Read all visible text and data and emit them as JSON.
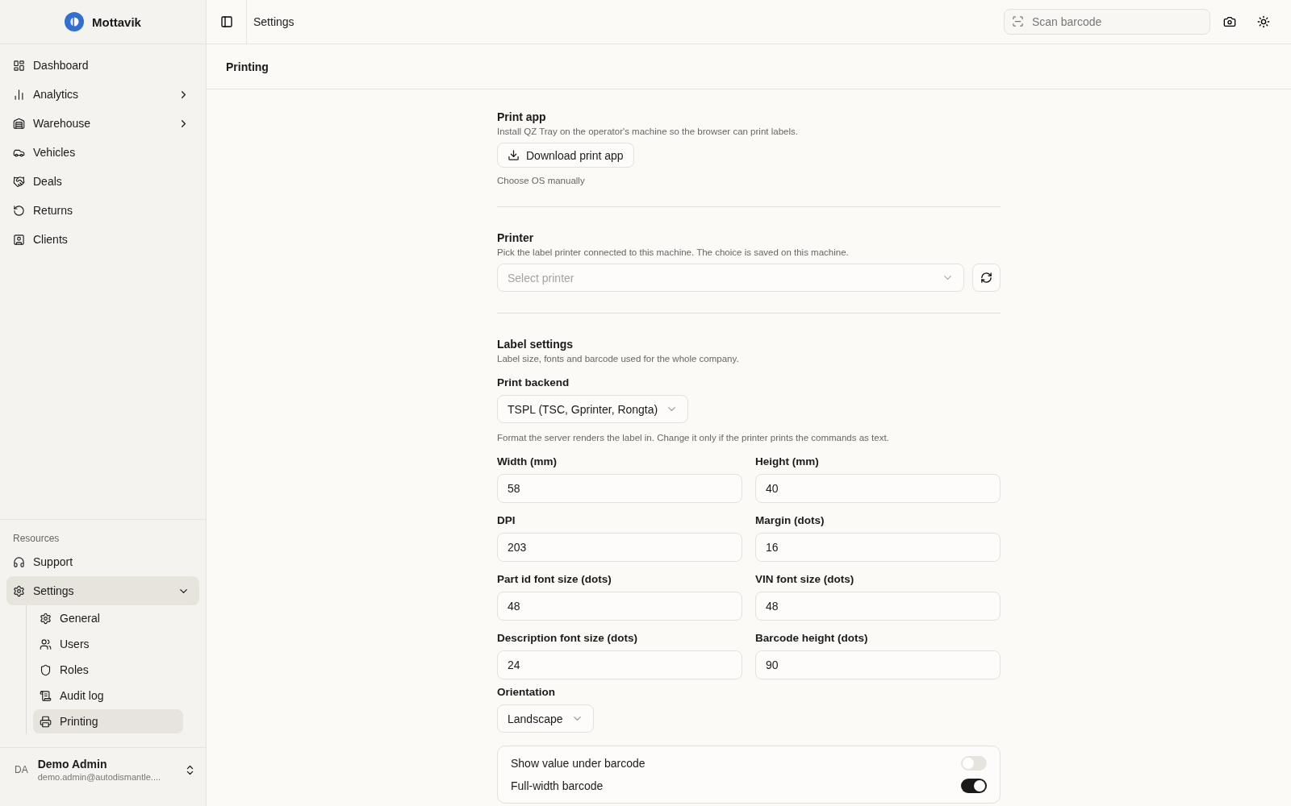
{
  "brand": {
    "name": "Mottavik"
  },
  "sidebar": {
    "items": [
      {
        "kind": "link",
        "label": "Dashboard",
        "selected": false
      },
      {
        "kind": "group",
        "label": "Analytics",
        "selected": false,
        "expanded": false
      },
      {
        "kind": "group",
        "label": "Warehouse",
        "selected": false,
        "expanded": false
      },
      {
        "kind": "link",
        "label": "Vehicles",
        "selected": false
      },
      {
        "kind": "link",
        "label": "Deals",
        "selected": false
      },
      {
        "kind": "link",
        "label": "Returns",
        "selected": false
      },
      {
        "kind": "link",
        "label": "Clients",
        "selected": false
      }
    ],
    "resources_heading": "Resources",
    "resources": [
      {
        "kind": "link",
        "label": "Support",
        "selected": false
      },
      {
        "kind": "group",
        "label": "Settings",
        "selected": true,
        "expanded": true,
        "children": [
          {
            "label": "General",
            "selected": false
          },
          {
            "label": "Users",
            "selected": false
          },
          {
            "label": "Roles",
            "selected": false
          },
          {
            "label": "Audit log",
            "selected": false
          },
          {
            "label": "Printing",
            "selected": true
          }
        ]
      }
    ],
    "user": {
      "initials": "DA",
      "name": "Demo Admin",
      "email": "demo.admin@autodismantle...."
    }
  },
  "topbar": {
    "breadcrumb": "Settings",
    "scan": {
      "placeholder": "Scan barcode"
    }
  },
  "page_title": "Printing",
  "print_app": {
    "title": "Print app",
    "description": "Install QZ Tray on the operator's machine so the browser can print labels.",
    "button": "Download print app",
    "link": "Choose OS manually"
  },
  "printer": {
    "title": "Printer",
    "description": "Pick the label printer connected to this machine. The choice is saved on this machine.",
    "select": {
      "placeholder": "Select printer"
    }
  },
  "label_settings": {
    "title": "Label settings",
    "description": "Label size, fonts and barcode used for the whole company.",
    "backend": {
      "label": "Print backend",
      "value": "TSPL (TSC, Gprinter, Rongta)",
      "help": "Format the server renders the label in. Change it only if the printer prints the commands as text."
    },
    "fields": [
      {
        "label": "Width (mm)",
        "value": "58"
      },
      {
        "label": "Height (mm)",
        "value": "40"
      },
      {
        "label": "DPI",
        "value": "203"
      },
      {
        "label": "Margin (dots)",
        "value": "16"
      },
      {
        "label": "Part id font size (dots)",
        "value": "48"
      },
      {
        "label": "VIN font size (dots)",
        "value": "48"
      },
      {
        "label": "Description font size (dots)",
        "value": "24"
      },
      {
        "label": "Barcode height (dots)",
        "value": "90"
      }
    ],
    "orientation": {
      "label": "Orientation",
      "value": "Landscape"
    },
    "toggles": [
      {
        "label": "Show value under barcode",
        "on": false
      },
      {
        "label": "Full-width barcode",
        "on": true
      }
    ]
  }
}
